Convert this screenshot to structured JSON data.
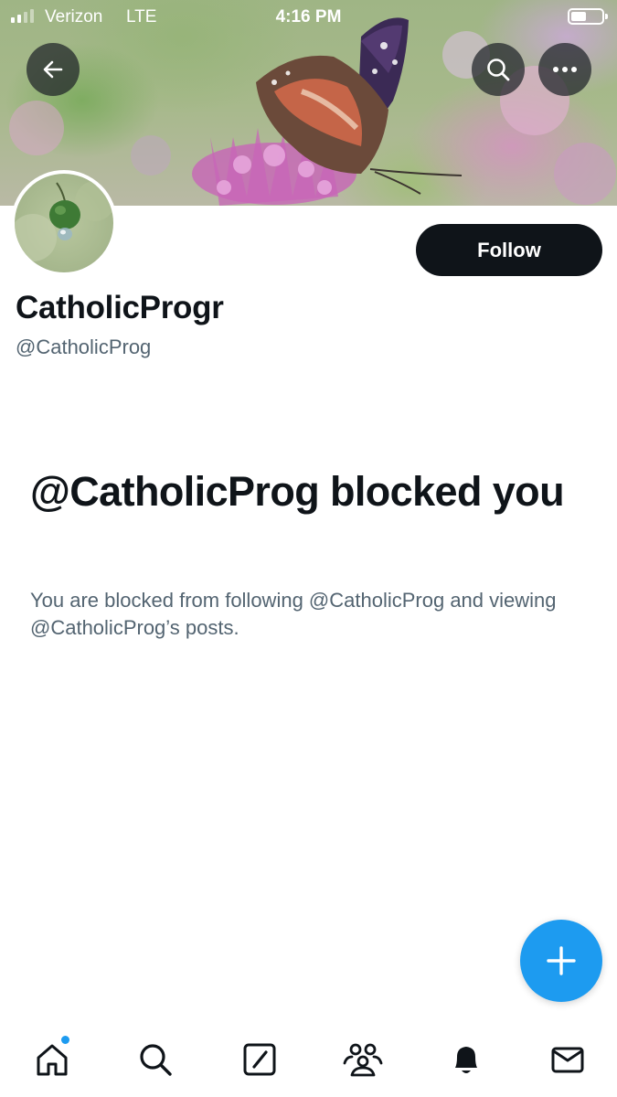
{
  "status_bar": {
    "carrier": "Verizon",
    "network": "LTE",
    "time": "4:16 PM"
  },
  "header": {
    "back_icon": "arrow-left-icon",
    "search_icon": "search-icon",
    "more_icon": "more-horizontal-icon"
  },
  "profile": {
    "display_name": "CatholicProgr",
    "handle": "@CatholicProg",
    "follow_label": "Follow"
  },
  "blocked": {
    "title": "@CatholicProg blocked you",
    "description": "You are blocked from following @CatholicProg and viewing @CatholicProg’s posts."
  },
  "fab": {
    "icon": "plus-icon"
  },
  "bottom_nav": {
    "items": [
      "home-icon",
      "search-icon",
      "compose-icon",
      "communities-icon",
      "notifications-icon",
      "messages-icon"
    ],
    "home_has_notification_dot": true
  },
  "colors": {
    "accent": "#1d9bf0",
    "text_primary": "#0f1419",
    "text_secondary": "#536471",
    "button_dark": "#0f1419"
  }
}
